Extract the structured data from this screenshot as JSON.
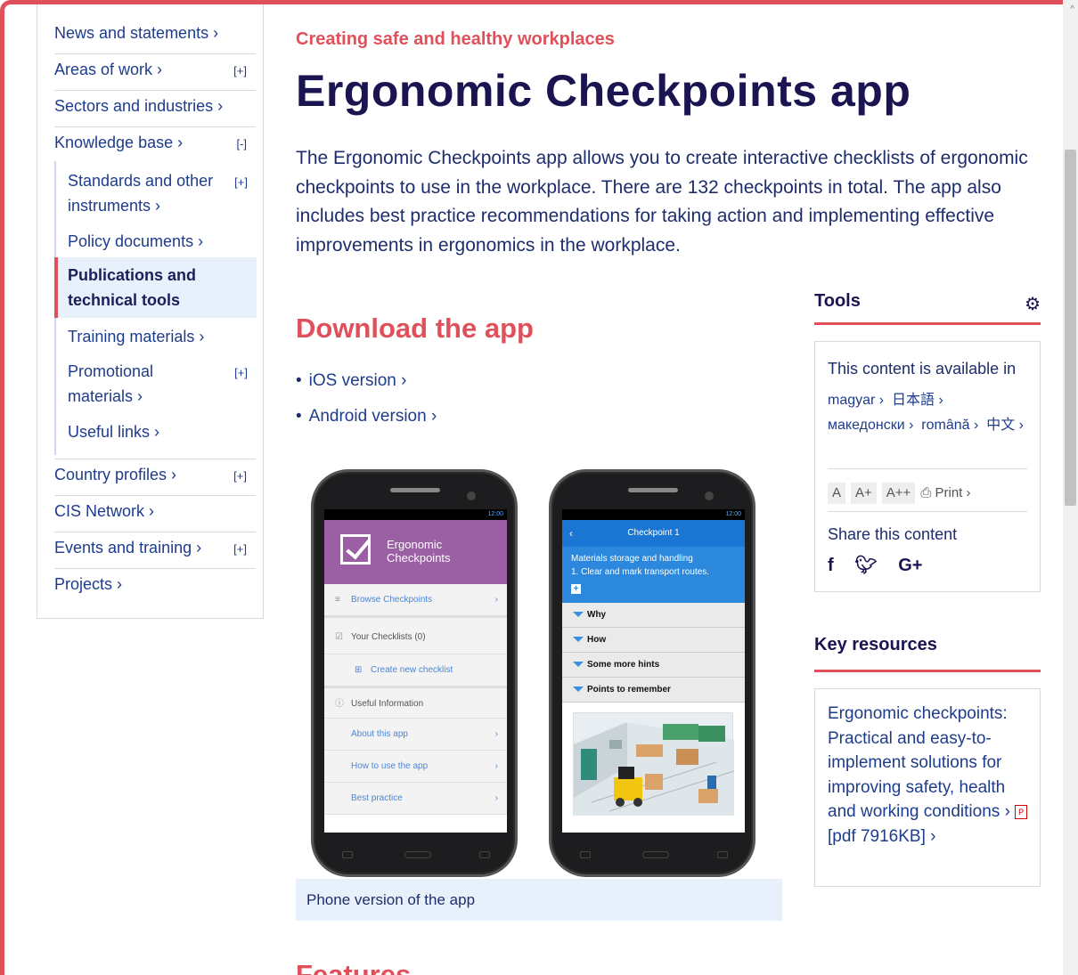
{
  "sidebar": {
    "items": [
      {
        "label": "News and statements ›",
        "toggle": ""
      },
      {
        "label": "Areas of work ›",
        "toggle": "[+]"
      },
      {
        "label": "Sectors and industries ›",
        "toggle": ""
      },
      {
        "label": "Knowledge base ›",
        "toggle": "[-]"
      },
      {
        "label": "Country profiles ›",
        "toggle": "[+]"
      },
      {
        "label": "CIS Network ›",
        "toggle": ""
      },
      {
        "label": "Events and training ›",
        "toggle": "[+]"
      },
      {
        "label": "Projects ›",
        "toggle": ""
      }
    ],
    "subitems": [
      {
        "label": "Standards and other instruments ›",
        "toggle": "[+]"
      },
      {
        "label": "Policy documents ›",
        "toggle": ""
      },
      {
        "label": "Publications and technical tools",
        "toggle": ""
      },
      {
        "label": "Training materials ›",
        "toggle": ""
      },
      {
        "label": "Promotional materials ›",
        "toggle": "[+]"
      },
      {
        "label": "Useful links ›",
        "toggle": ""
      }
    ]
  },
  "main": {
    "kicker": "Creating safe and healthy workplaces",
    "title": "Ergonomic Checkpoints app",
    "intro": "The Ergonomic Checkpoints app allows you to create interactive checklists of ergonomic checkpoints to use in the workplace. There are 132 checkpoints in total. The app also includes best practice recommendations for taking action and implementing effective improvements in ergonomics in the workplace.",
    "download_heading": "Download the app",
    "downloads": [
      "iOS version ›",
      "Android version ›"
    ],
    "caption": "Phone version of the app",
    "features_heading": "Features"
  },
  "phone1": {
    "status": "12:00",
    "app_title_1": "Ergonomic",
    "app_title_2": "Checkpoints",
    "rows": {
      "browse": "Browse Checkpoints",
      "checklists": "Your Checklists (0)",
      "create": "Create new checklist",
      "useful": "Useful Information",
      "about": "About this app",
      "howto": "How to use the app",
      "best": "Best practice"
    }
  },
  "phone2": {
    "status": "12:00",
    "header": "Checkpoint 1",
    "category": "Materials storage and handling",
    "item": "1.   Clear and mark transport routes.",
    "sections": [
      "Why",
      "How",
      "Some more hints",
      "Points to remember"
    ]
  },
  "tools": {
    "heading": "Tools",
    "available_in": "This content is available in",
    "languages": [
      "magyar ›",
      "日本語 ›",
      "македонски ›",
      "română ›",
      "中文 ›"
    ],
    "font_sizes": [
      "A",
      "A+",
      "A++"
    ],
    "print": "Print ›",
    "share_label": "Share this content",
    "social": [
      "f",
      "t",
      "G+"
    ]
  },
  "key_resources": {
    "heading": "Key resources",
    "link": "Ergonomic checkpoints: Practical and easy-to-implement solutions for improving safety, health and working conditions ›",
    "pdf": "[pdf 7916KB] ›"
  },
  "colors": {
    "accent": "#e0505a",
    "navy": "#1a1450",
    "link": "#1e3c8c",
    "active_bg": "#e8f0fb"
  }
}
